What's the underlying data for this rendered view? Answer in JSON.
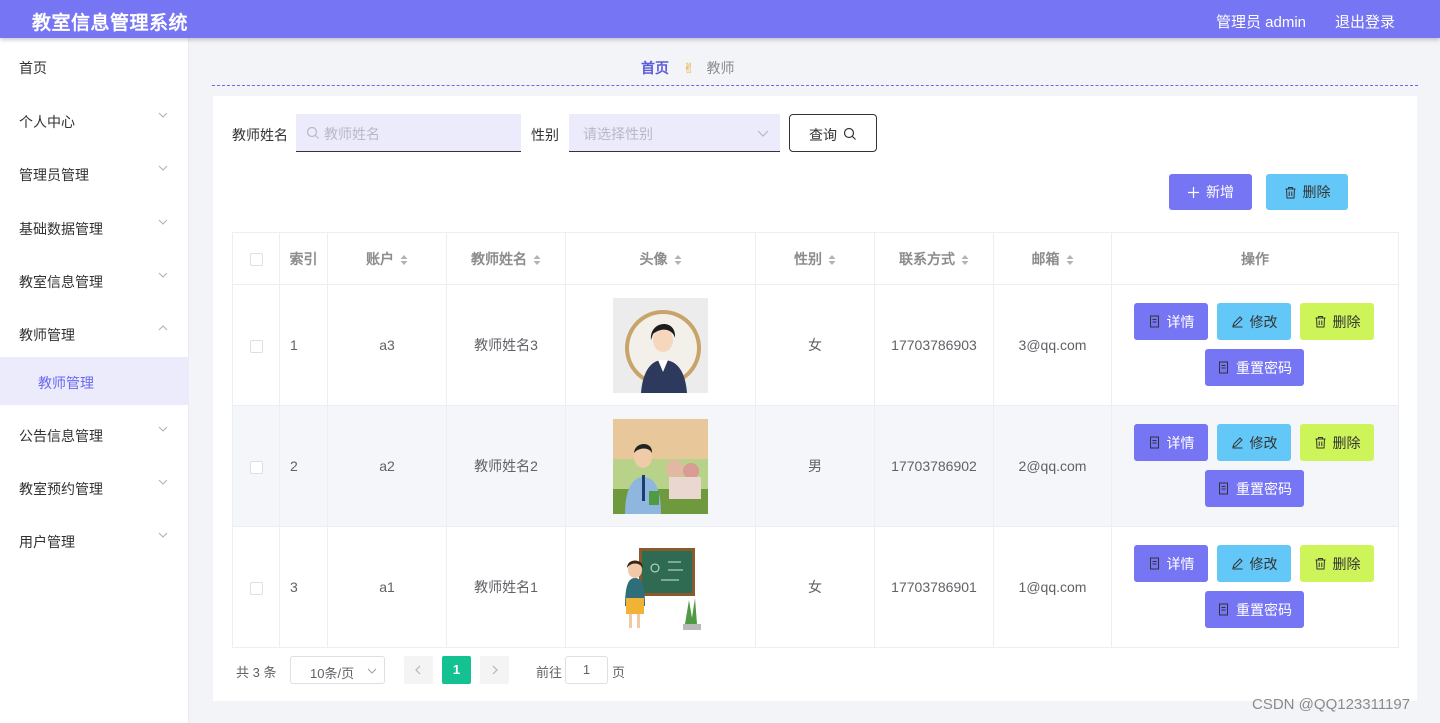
{
  "app": {
    "title": "教室信息管理系统",
    "user": "管理员 admin",
    "logout": "退出登录"
  },
  "sidebar": {
    "items": [
      {
        "label": "首页"
      },
      {
        "label": "个人中心"
      },
      {
        "label": "管理员管理"
      },
      {
        "label": "基础数据管理"
      },
      {
        "label": "教室信息管理"
      },
      {
        "label": "教师管理"
      },
      {
        "label": "公告信息管理"
      },
      {
        "label": "教室预约管理"
      },
      {
        "label": "用户管理"
      }
    ],
    "active_sub": "教师管理"
  },
  "breadcrumb": {
    "home": "首页",
    "separator_icon": "victory-hand-icon",
    "current": "教师",
    "separator_emoji": "✌"
  },
  "search": {
    "name_label": "教师姓名",
    "name_placeholder": "教师姓名",
    "gender_label": "性别",
    "gender_placeholder": "请选择性别",
    "query_button": "查询"
  },
  "actions": {
    "add": "新增",
    "delete": "删除"
  },
  "table": {
    "headers": {
      "index": "索引",
      "account": "账户",
      "name": "教师姓名",
      "avatar": "头像",
      "gender": "性别",
      "phone": "联系方式",
      "email": "邮箱",
      "ops": "操作"
    },
    "rows": [
      {
        "index": "1",
        "account": "a3",
        "name": "教师姓名3",
        "gender": "女",
        "phone": "17703786903",
        "email": "3@qq.com"
      },
      {
        "index": "2",
        "account": "a2",
        "name": "教师姓名2",
        "gender": "男",
        "phone": "17703786902",
        "email": "2@qq.com"
      },
      {
        "index": "3",
        "account": "a1",
        "name": "教师姓名1",
        "gender": "女",
        "phone": "17703786901",
        "email": "1@qq.com"
      }
    ],
    "row_actions": {
      "detail": "详情",
      "edit": "修改",
      "delete": "删除",
      "reset": "重置密码"
    }
  },
  "pagination": {
    "total": "共 3 条",
    "page_size": "10条/页",
    "current": "1",
    "goto": "前往",
    "goto_value": "1",
    "page_unit": "页"
  },
  "colors": {
    "accent": "#7675f3",
    "info": "#63c8f8",
    "danger": "#cdf55a",
    "page_active": "#13c191"
  },
  "watermark": "CSDN @QQ123311197"
}
